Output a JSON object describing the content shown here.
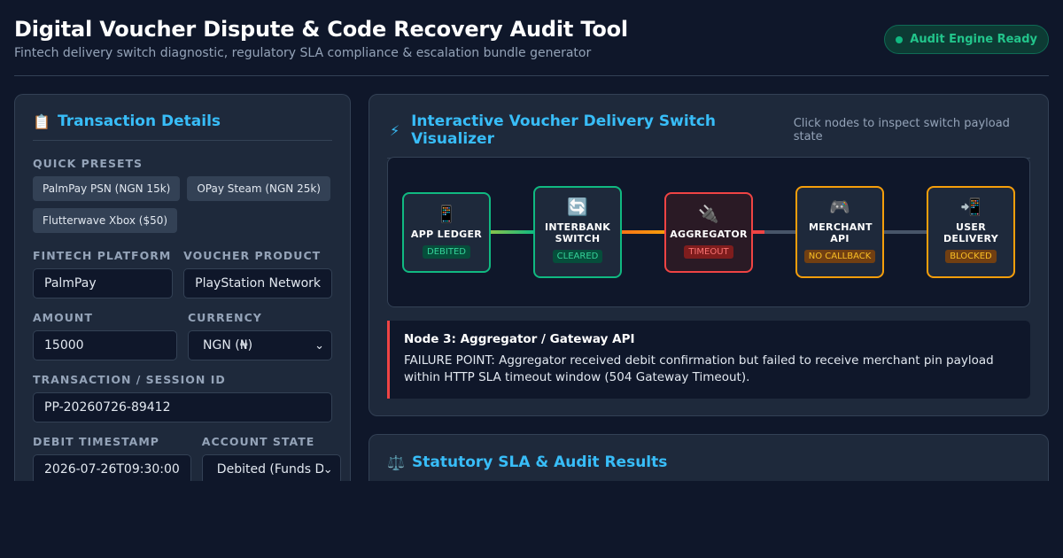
{
  "header": {
    "title": "Digital Voucher Dispute & Code Recovery Audit Tool",
    "subtitle": "Fintech delivery switch diagnostic, regulatory SLA compliance & escalation bundle generator",
    "status": "Audit Engine Ready"
  },
  "transaction": {
    "icon": "clipboard-icon",
    "title": "Transaction Details",
    "presets_label": "Quick Presets",
    "presets": [
      "PalmPay PSN (NGN 15k)",
      "OPay Steam (NGN 25k)",
      "Flutterwave Xbox ($50)"
    ],
    "platform_label": "Fintech Platform",
    "platform_value": "PalmPay",
    "product_label": "Voucher Product",
    "product_value": "PlayStation Network",
    "amount_label": "Amount",
    "amount_value": "15000",
    "currency_label": "Currency",
    "currency_value": "NGN (₦)",
    "session_label": "Transaction / Session ID",
    "session_value": "PP-20260726-89412",
    "timestamp_label": "Debit Timestamp",
    "timestamp_value": "2026-07-26T09:30:00",
    "state_label": "Account State",
    "state_value": "Debited (Funds Deducted)"
  },
  "visualizer": {
    "icon": "lightning-icon",
    "title": "Interactive Voucher Delivery Switch Visualizer",
    "hint": "Click nodes to inspect switch payload state",
    "nodes": [
      {
        "icon": "phone-icon",
        "glyph": "📱",
        "label": "APP LEDGER",
        "status": "DEBITED",
        "tone": "green"
      },
      {
        "icon": "switch-icon",
        "glyph": "🔄",
        "label": "INTERBANK SWITCH",
        "status": "CLEARED",
        "tone": "green"
      },
      {
        "icon": "plug-icon",
        "glyph": "🔌",
        "label": "AGGREGATOR",
        "status": "TIMEOUT",
        "tone": "red"
      },
      {
        "icon": "gamepad-icon",
        "glyph": "🎮",
        "label": "MERCHANT API",
        "status": "NO CALLBACK",
        "tone": "amber"
      },
      {
        "icon": "phone-arrow-icon",
        "glyph": "📲",
        "label": "USER DELIVERY",
        "status": "BLOCKED",
        "tone": "amber"
      }
    ],
    "detail_title": "Node 3: Aggregator / Gateway API",
    "detail_text": "FAILURE POINT: Aggregator received debit confirmation but failed to receive merchant pin payload within HTTP SLA timeout window (504 Gateway Timeout)."
  },
  "sla": {
    "icon": "scales-icon",
    "title": "Statutory SLA & Audit Results"
  },
  "colors": {
    "background": "#0f172a",
    "panel": "#1e293b",
    "accent": "#38bdf8",
    "success": "#10b981",
    "danger": "#ef4444",
    "warning": "#f59e0b"
  }
}
